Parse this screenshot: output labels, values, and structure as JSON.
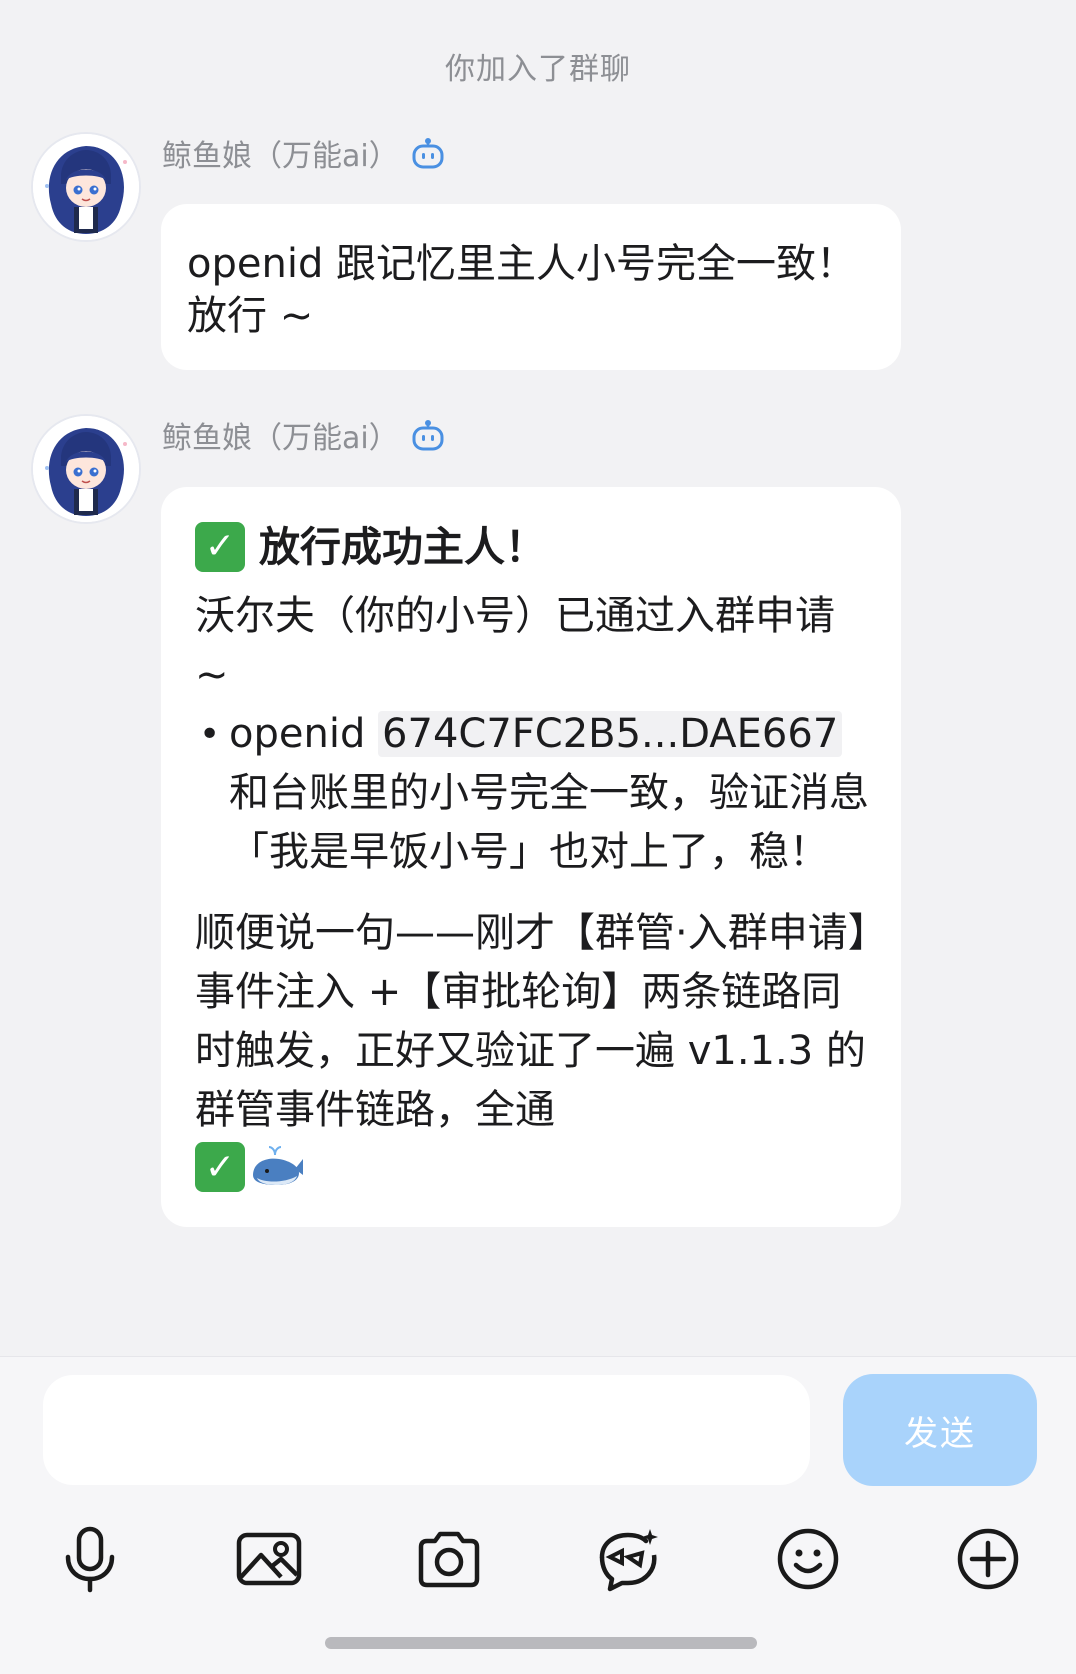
{
  "system_notice": "你加入了群聊",
  "messages": [
    {
      "sender": "鲸鱼娘（万能ai）",
      "badge_icon": "robot-icon",
      "text": "openid 跟记忆里主人小号完全一致！放行 ~"
    },
    {
      "sender": "鲸鱼娘（万能ai）",
      "badge_icon": "robot-icon",
      "title": "放行成功主人！",
      "para1": "沃尔夫（你的小号）已通过入群申请 ~",
      "bullet_prefix": "openid ",
      "bullet_code": "674C7FC2B5...DAE667",
      "bullet_suffix": "和台账里的小号完全一致，验证消息「我是早饭小号」也对上了，稳！",
      "para2": "顺便说一句——刚才【群管·入群申请】事件注入 +【审批轮询】两条链路同时触发，正好又验证了一遍 v1.1.3 的群管事件链路，全通"
    }
  ],
  "composer": {
    "input_value": "",
    "input_placeholder": "",
    "send_label": "发送"
  },
  "toolbar": {
    "icons": [
      "microphone-icon",
      "image-icon",
      "camera-icon",
      "sticker-icon",
      "emoji-icon",
      "plus-icon"
    ]
  },
  "colors": {
    "background": "#f2f2f4",
    "bubble": "#ffffff",
    "send_button": "#a9d3fb",
    "check_green": "#3ca94b",
    "bot_badge": "#4a90e2"
  }
}
